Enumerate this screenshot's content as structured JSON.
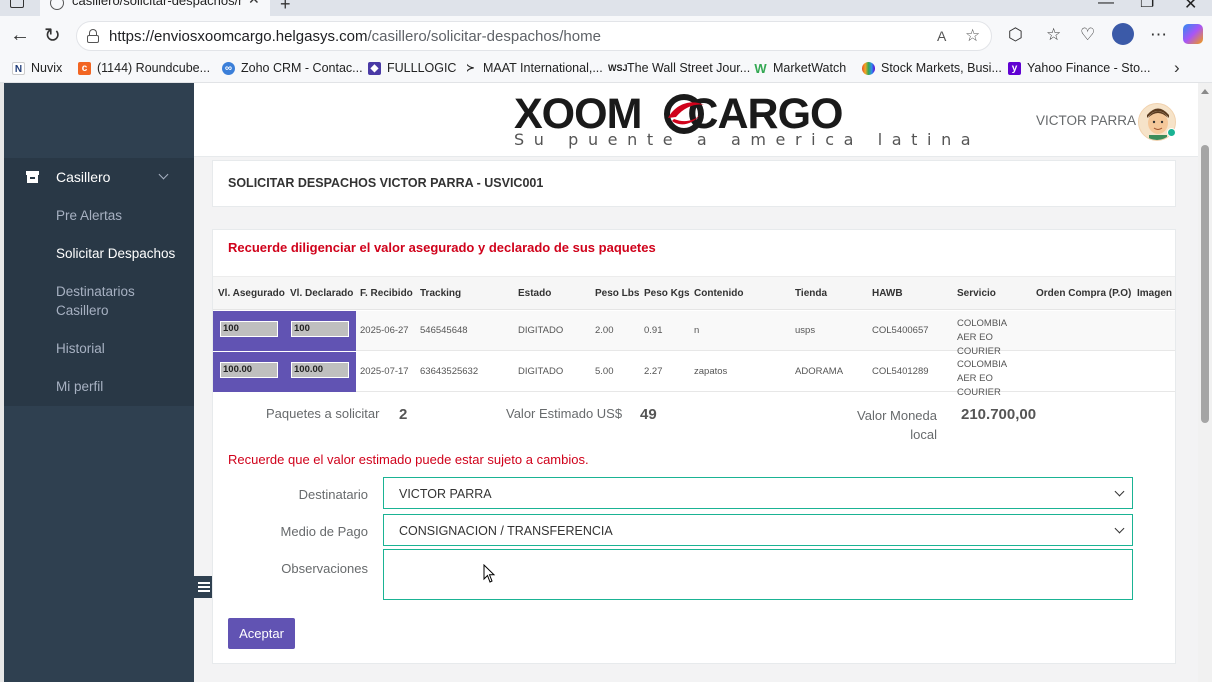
{
  "browser": {
    "tab_title": "casillero/solicitar-despachos/home",
    "url_host": "https://enviosxoomcargo.helgasys.com",
    "url_path": "/casillero/solicitar-despachos/home",
    "bookmarks": [
      {
        "label": "Nuvix",
        "icon": "nuvix-icon",
        "color": "#ffffff"
      },
      {
        "label": "(1144) Roundcube...",
        "icon": "roundcube-icon",
        "color": "#f26522"
      },
      {
        "label": "Zoho CRM - Contac...",
        "icon": "zoho-icon",
        "color": "#3b7fd9"
      },
      {
        "label": "FULLLOGIC",
        "icon": "fulllogic-icon",
        "color": "#4a3aa6"
      },
      {
        "label": "MAAT International,...",
        "icon": "maat-icon",
        "color": "#222222"
      },
      {
        "label": "The Wall Street Jour...",
        "icon": "wsj-icon",
        "color": "#222222"
      },
      {
        "label": "MarketWatch",
        "icon": "marketwatch-icon",
        "color": "#34a853"
      },
      {
        "label": "Stock Markets, Busi...",
        "icon": "nbc-icon",
        "color": "#e24e27"
      },
      {
        "label": "Yahoo Finance - Sto...",
        "icon": "yahoo-icon",
        "color": "#6001d2"
      }
    ]
  },
  "sidebar": {
    "section": "Casillero",
    "items": [
      {
        "label": "Pre Alertas",
        "active": false
      },
      {
        "label": "Solicitar Despachos",
        "active": true
      },
      {
        "label": "Destinatarios Casillero",
        "active": false
      },
      {
        "label": "Historial",
        "active": false
      },
      {
        "label": "Mi perfil",
        "active": false
      }
    ]
  },
  "header": {
    "logo_main": "XOOM",
    "logo_second": "CARGO",
    "logo_tagline": "Su puente a america latina",
    "user_name": "VICTOR PARRA"
  },
  "page": {
    "title": "SOLICITAR DESPACHOS VICTOR PARRA - USVIC001",
    "reminder": "Recuerde diligenciar el valor asegurado y declarado de sus paquetes",
    "columns": [
      "Vl. Asegurado",
      "Vl. Declarado",
      "F. Recibido",
      "Tracking",
      "Estado",
      "Peso Lbs",
      "Peso Kgs",
      "Contenido",
      "Tienda",
      "HAWB",
      "Servicio",
      "Orden Compra (P.O)",
      "Imagen"
    ],
    "rows": [
      {
        "asegurado": "100",
        "declarado": "100",
        "recibido": "2025-06-27",
        "tracking": "546545648",
        "estado": "DIGITADO",
        "lbs": "2.00",
        "kgs": "0.91",
        "contenido": "n",
        "tienda": "usps",
        "hawb": "COL5400657",
        "servicio": "COLOMBIA AER EO COURIER",
        "orden": "",
        "imagen": ""
      },
      {
        "asegurado": "100.00",
        "declarado": "100.00",
        "recibido": "2025-07-17",
        "tracking": "63643525632",
        "estado": "DIGITADO",
        "lbs": "5.00",
        "kgs": "2.27",
        "contenido": "zapatos",
        "tienda": "ADORAMA",
        "hawb": "COL5401289",
        "servicio": "COLOMBIA AER EO COURIER",
        "orden": "",
        "imagen": ""
      }
    ],
    "summary": {
      "paquetes_label": "Paquetes a solicitar",
      "paquetes_value": "2",
      "valor_usd_label": "Valor Estimado US$",
      "valor_usd_value": "49",
      "valor_local_label": "Valor Moneda local",
      "valor_local_value": "210.700,00"
    },
    "note": "Recuerde que el valor estimado puede estar sujeto a cambios.",
    "form": {
      "destinatario_label": "Destinatario",
      "destinatario_value": "VICTOR PARRA",
      "medio_label": "Medio de Pago",
      "medio_value": "CONSIGNACION / TRANSFERENCIA",
      "observaciones_label": "Observaciones",
      "observaciones_value": ""
    },
    "submit_label": "Aceptar"
  },
  "colors": {
    "sidebar": "#2f4050",
    "sidebar_active": "#293846",
    "accent_purple": "#6153b3",
    "warning_red": "#d0021b",
    "field_border_green": "#1ab394"
  }
}
